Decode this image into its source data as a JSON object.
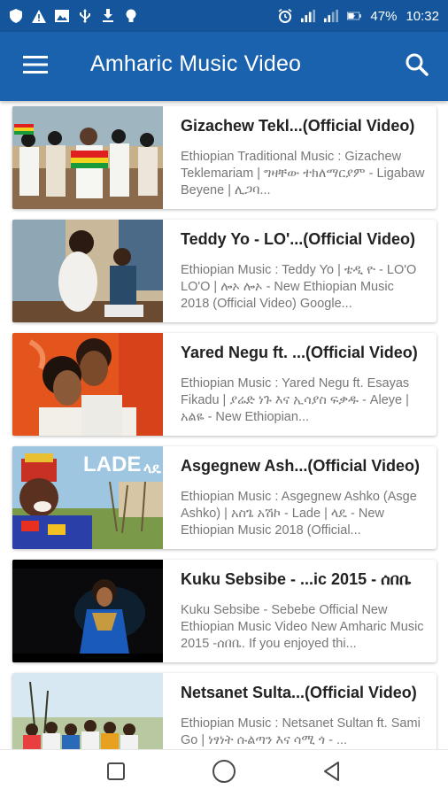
{
  "status_bar": {
    "battery": "47%",
    "time": "10:32"
  },
  "app_bar": {
    "title": "Amharic Music Video"
  },
  "videos": [
    {
      "title": "Gizachew Tekl...(Official Video)",
      "description": "Ethiopian Traditional Music : Gizachew Teklemariam | ግዛቸው ተክለማርያም - Ligabaw Beyene | ሊጋባ..."
    },
    {
      "title": "Teddy Yo - LO'...(Official Video)",
      "description": "Ethiopian Music : Teddy Yo | ቴዲ ዮ - LO'O LO'O | ሎኦ ሎኦ - New Ethiopian Music 2018 (Official Video) Google..."
    },
    {
      "title": "Yared Negu ft. ...(Official Video)",
      "description": "Ethiopian Music : Yared Negu ft. Esayas Fikadu | ያሬድ ነጉ እና ኢሳያስ ፍቃዱ - Aleye | አልዬ - New Ethiopian..."
    },
    {
      "title": "Asgegnew Ash...(Official Video)",
      "description": "Ethiopian Music : Asgegnew Ashko (Asge Ashko) | አስጌ አሽኮ - Lade | ላዴ - New Ethiopian Music 2018 (Official..."
    },
    {
      "title": "Kuku Sebsibe - ...ic 2015 - ሰበቤ",
      "description": "Kuku Sebsibe - Sebebe Official New Ethiopian Music Video New Amharic Music 2015 -ሰበቤ. If you enjoyed thi..."
    },
    {
      "title": "Netsanet Sulta...(Official Video)",
      "description": "Ethiopian Music : Netsanet Sultan ft. Sami Go | ነፃነት ሱልጣን እና ሳሚ ጎ - ..."
    }
  ],
  "thumbnail_text": {
    "lade": "LADE",
    "lade_amharic": "ላዴ"
  },
  "icons": {
    "menu": "hamburger-menu-icon",
    "search": "search-icon",
    "back": "back-triangle-icon",
    "home": "home-circle-icon",
    "recents": "recents-square-icon"
  },
  "colors": {
    "status_bar": "#14559b",
    "app_bar": "#1a62ad",
    "title_text": "#222222",
    "desc_text": "#777777"
  }
}
